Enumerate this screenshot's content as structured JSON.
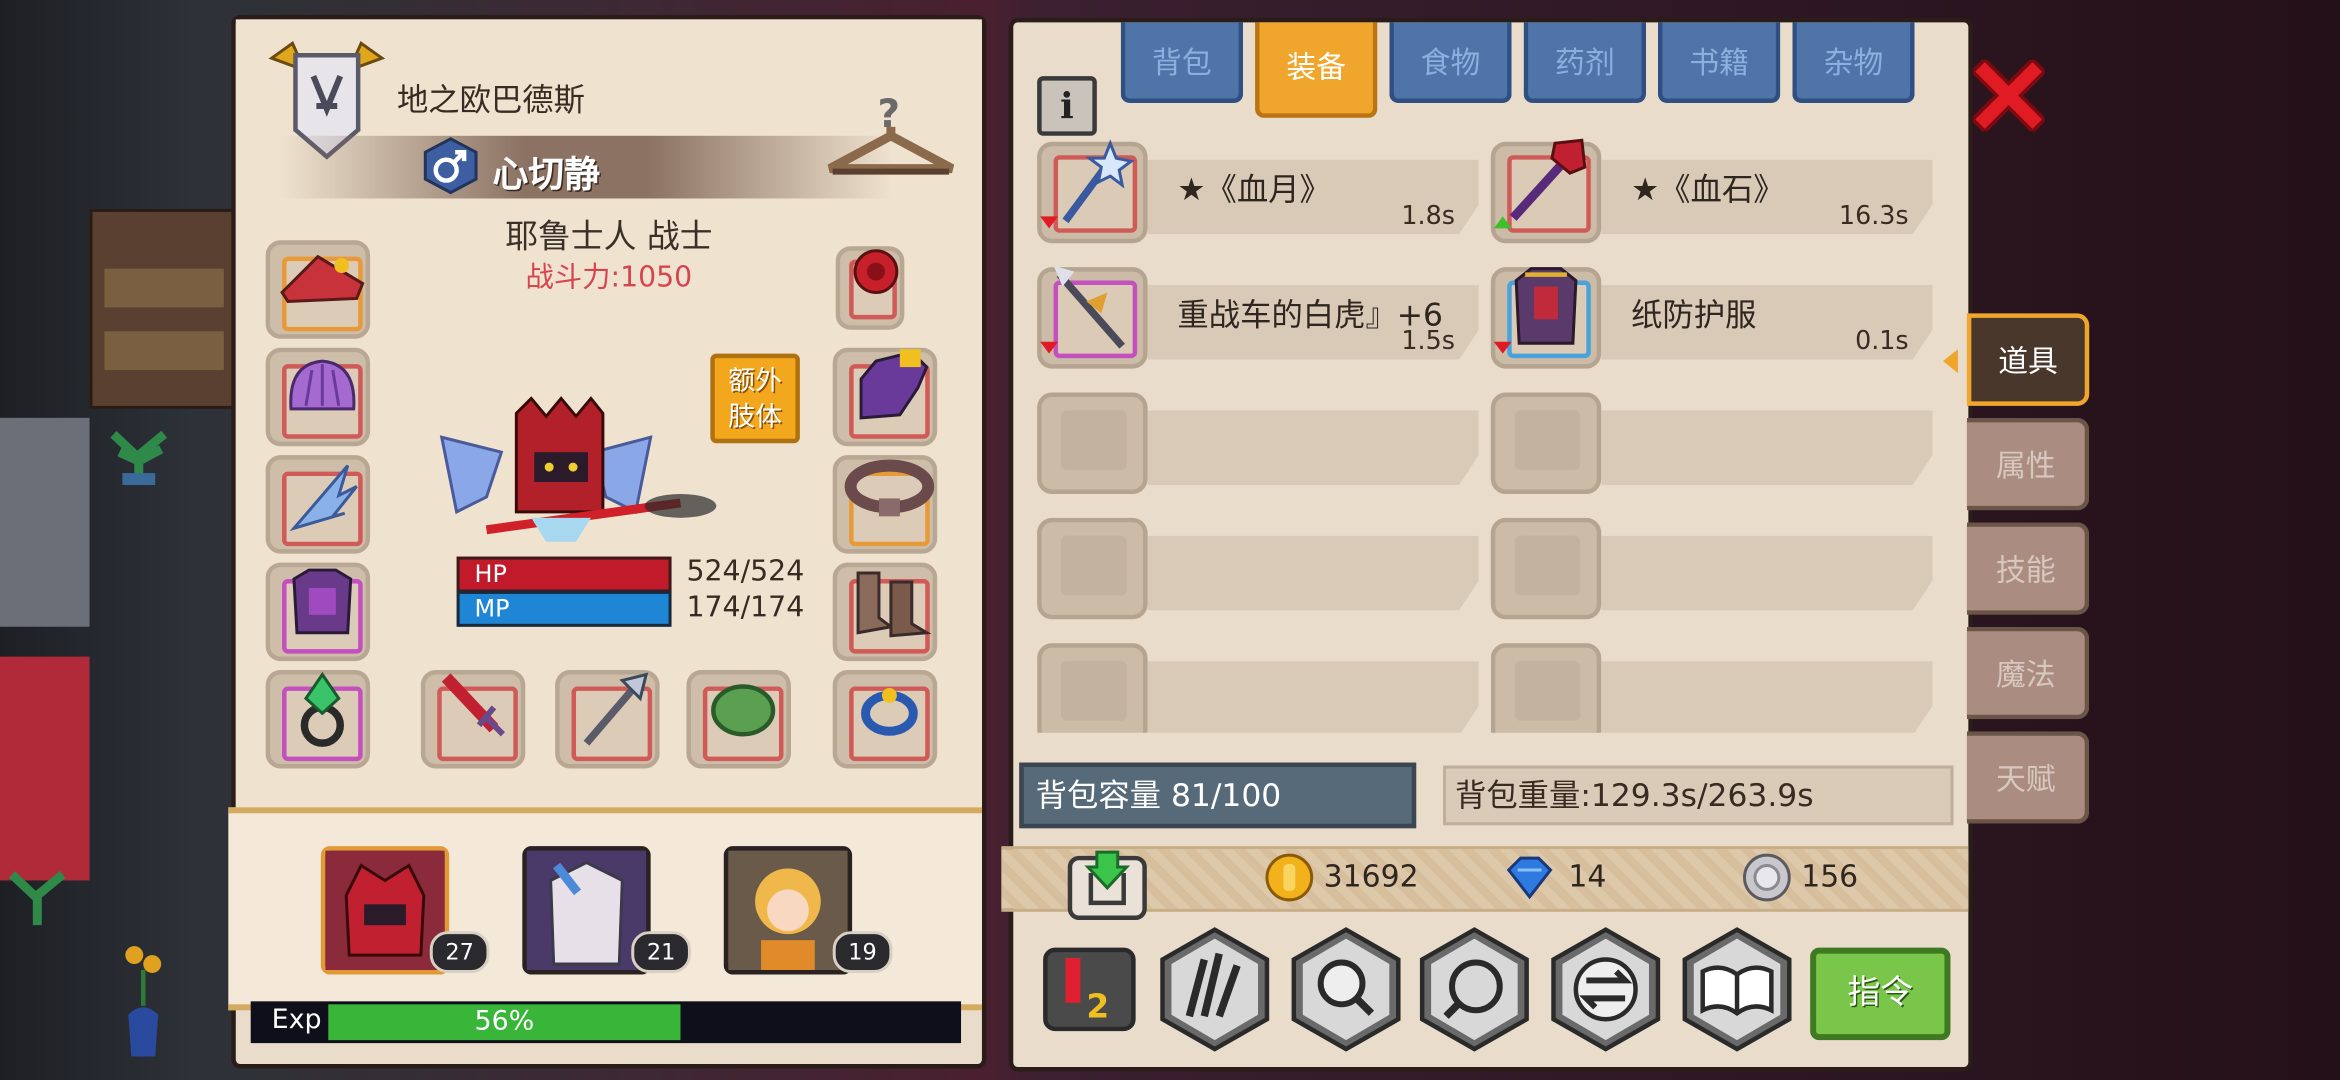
{
  "character": {
    "name": "地之欧巴德斯",
    "class_title": "心切静",
    "race_class": "耶鲁士人 战士",
    "power": "战斗力:1050",
    "extra_limb_line1": "额外",
    "extra_limb_line2": "肢体",
    "hp_label": "HP",
    "hp_value": "524/524",
    "mp_label": "MP",
    "mp_value": "174/174"
  },
  "party": [
    {
      "level": "27"
    },
    {
      "level": "21"
    },
    {
      "level": "19"
    }
  ],
  "exp": {
    "label": "Exp",
    "percent_text": "56%",
    "fraction": 0.56
  },
  "tabs": [
    "背包",
    "装备",
    "食物",
    "药剂",
    "书籍",
    "杂物"
  ],
  "active_tab": "装备",
  "items": [
    {
      "name": "★《血月》",
      "weight": "1.8s",
      "arrow": "down"
    },
    {
      "name": "★《血石》",
      "weight": "16.3s",
      "arrow": "up"
    },
    {
      "name": "重战车的白虎』+6",
      "weight": "1.5s",
      "arrow": "down"
    },
    {
      "name": "纸防护服",
      "weight": "0.1s",
      "arrow": "down"
    }
  ],
  "inventory": {
    "capacity": "背包容量 81/100",
    "weight": "背包重量:129.3s/263.9s"
  },
  "currency": {
    "gold": "31692",
    "gems": "14",
    "silver": "156"
  },
  "actions": {
    "page_icon": "page-1-2-icon",
    "command": "指令"
  },
  "side_tabs": [
    "道具",
    "属性",
    "技能",
    "魔法",
    "天赋"
  ],
  "active_side_tab": "道具",
  "icons": [
    "info-icon",
    "close-icon",
    "hanger-icon",
    "gender-male-icon",
    "guild-badge-icon",
    "download-icon",
    "gold-coin-icon",
    "gem-icon",
    "silver-coin-icon",
    "claw-icon",
    "magnify-icon",
    "search-icon",
    "swap-icon",
    "book-icon"
  ],
  "colors": {
    "accent": "#f0a62c",
    "tab": "#4f74a8",
    "hp": "#c11a2b",
    "mp": "#1f86d6",
    "exp": "#39b53a",
    "close": "#e01b24"
  }
}
